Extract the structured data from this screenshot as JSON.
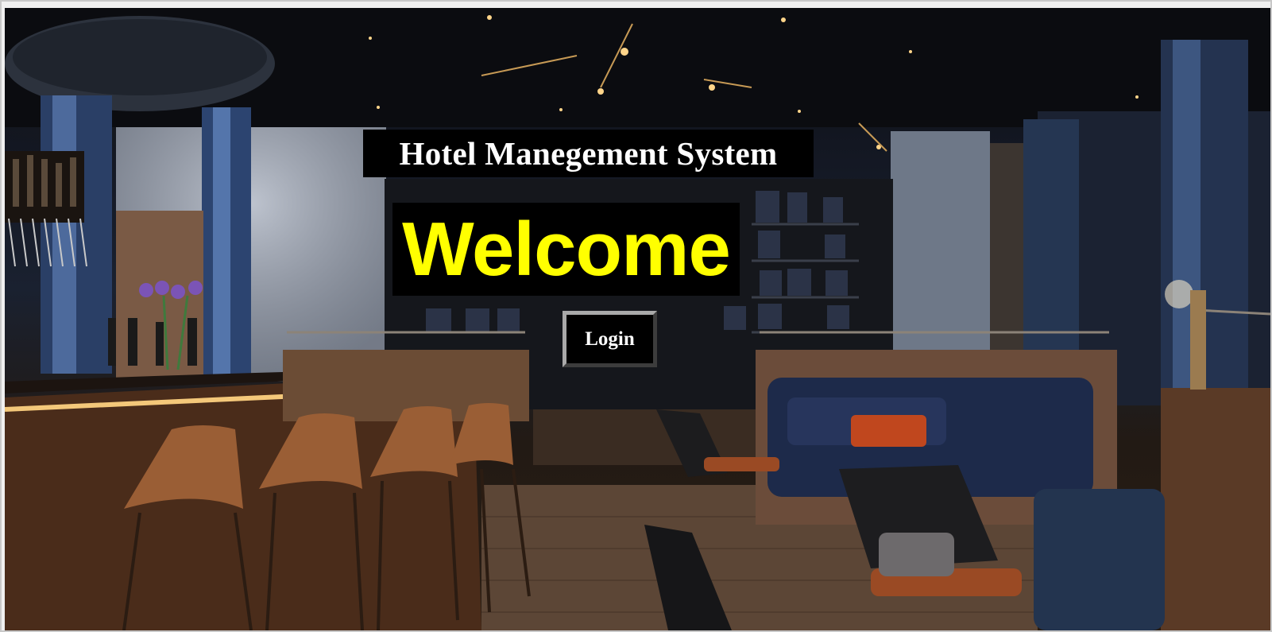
{
  "page": {
    "title": "Hotel Manegement System",
    "welcome": "Welcome",
    "login_label": "Login"
  },
  "colors": {
    "title_text": "#ffffff",
    "welcome_text": "#ffff00",
    "box_background": "#000000"
  },
  "background_image": "hotel-lobby-bar-interior"
}
